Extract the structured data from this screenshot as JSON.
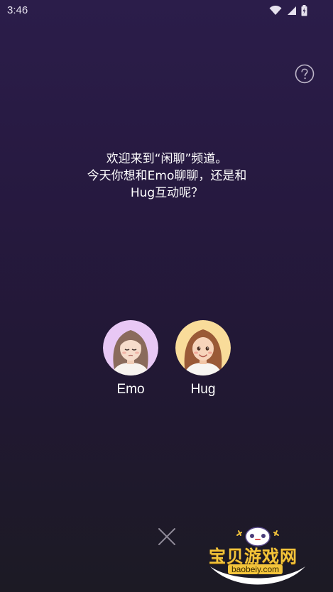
{
  "status_bar": {
    "time": "3:46",
    "icons": [
      "wifi-icon",
      "signal-icon",
      "battery-icon"
    ]
  },
  "help": {
    "icon": "question-circle-icon"
  },
  "welcome": {
    "line1": "欢迎来到“闲聊”频道。",
    "line2": "今天你想和Emo聊聊，还是和",
    "line3": "Hug互动呢？"
  },
  "characters": [
    {
      "name": "Emo",
      "avatar_bg": "#e8c8f5"
    },
    {
      "name": "Hug",
      "avatar_bg": "#f9dc9a"
    }
  ],
  "close": {
    "icon": "close-icon"
  },
  "watermark": {
    "title": "宝贝游戏网",
    "url": "baobeiy.com"
  },
  "colors": {
    "background_top": "#2b1d4a",
    "background_bottom": "#1c1a24",
    "text": "#ffffff",
    "watermark_gold": "#f3c43b"
  }
}
